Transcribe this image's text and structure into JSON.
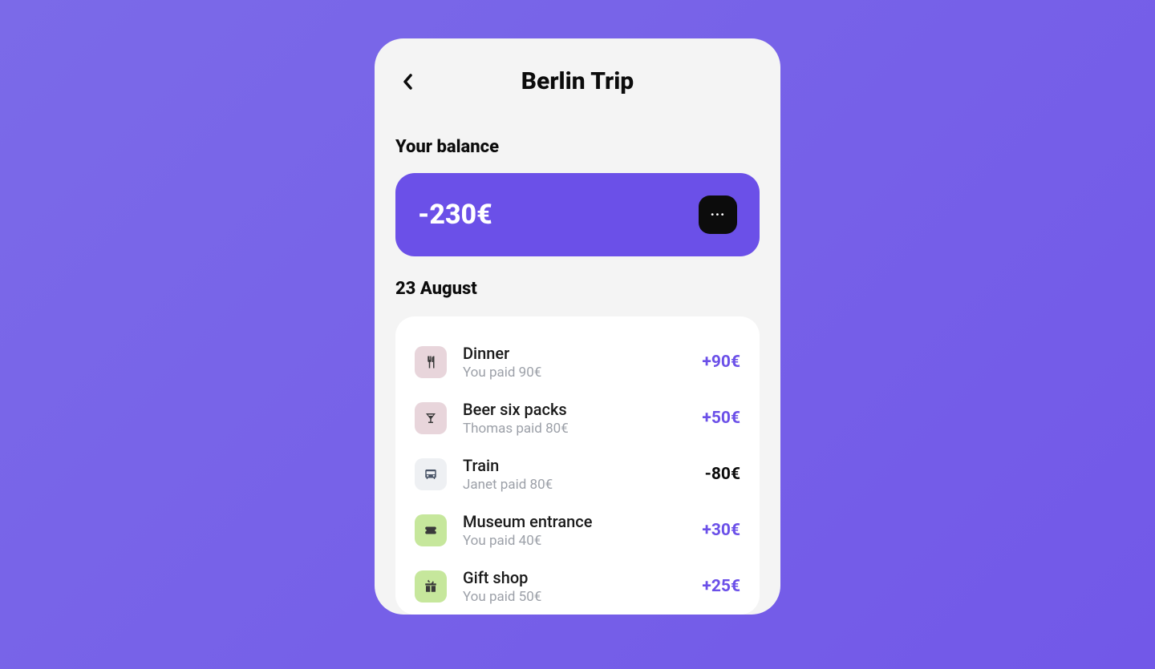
{
  "header": {
    "title": "Berlin Trip"
  },
  "balance": {
    "label": "Your balance",
    "amount": "-230€"
  },
  "date": "23 August",
  "expenses": [
    {
      "title": "Dinner",
      "sub": "You paid 90€",
      "amount": "+90€",
      "positive": true,
      "iconClass": "icon-pink",
      "iconName": "utensils-icon"
    },
    {
      "title": "Beer six packs",
      "sub": "Thomas paid 80€",
      "amount": "+50€",
      "positive": true,
      "iconClass": "icon-pink",
      "iconName": "cocktail-icon"
    },
    {
      "title": "Train",
      "sub": "Janet paid 80€",
      "amount": "-80€",
      "positive": false,
      "iconClass": "icon-gray",
      "iconName": "bus-icon"
    },
    {
      "title": "Museum entrance",
      "sub": "You paid 40€",
      "amount": "+30€",
      "positive": true,
      "iconClass": "icon-green",
      "iconName": "ticket-icon"
    },
    {
      "title": "Gift shop",
      "sub": "You paid 50€",
      "amount": "+25€",
      "positive": true,
      "iconClass": "icon-green",
      "iconName": "gift-icon"
    }
  ]
}
